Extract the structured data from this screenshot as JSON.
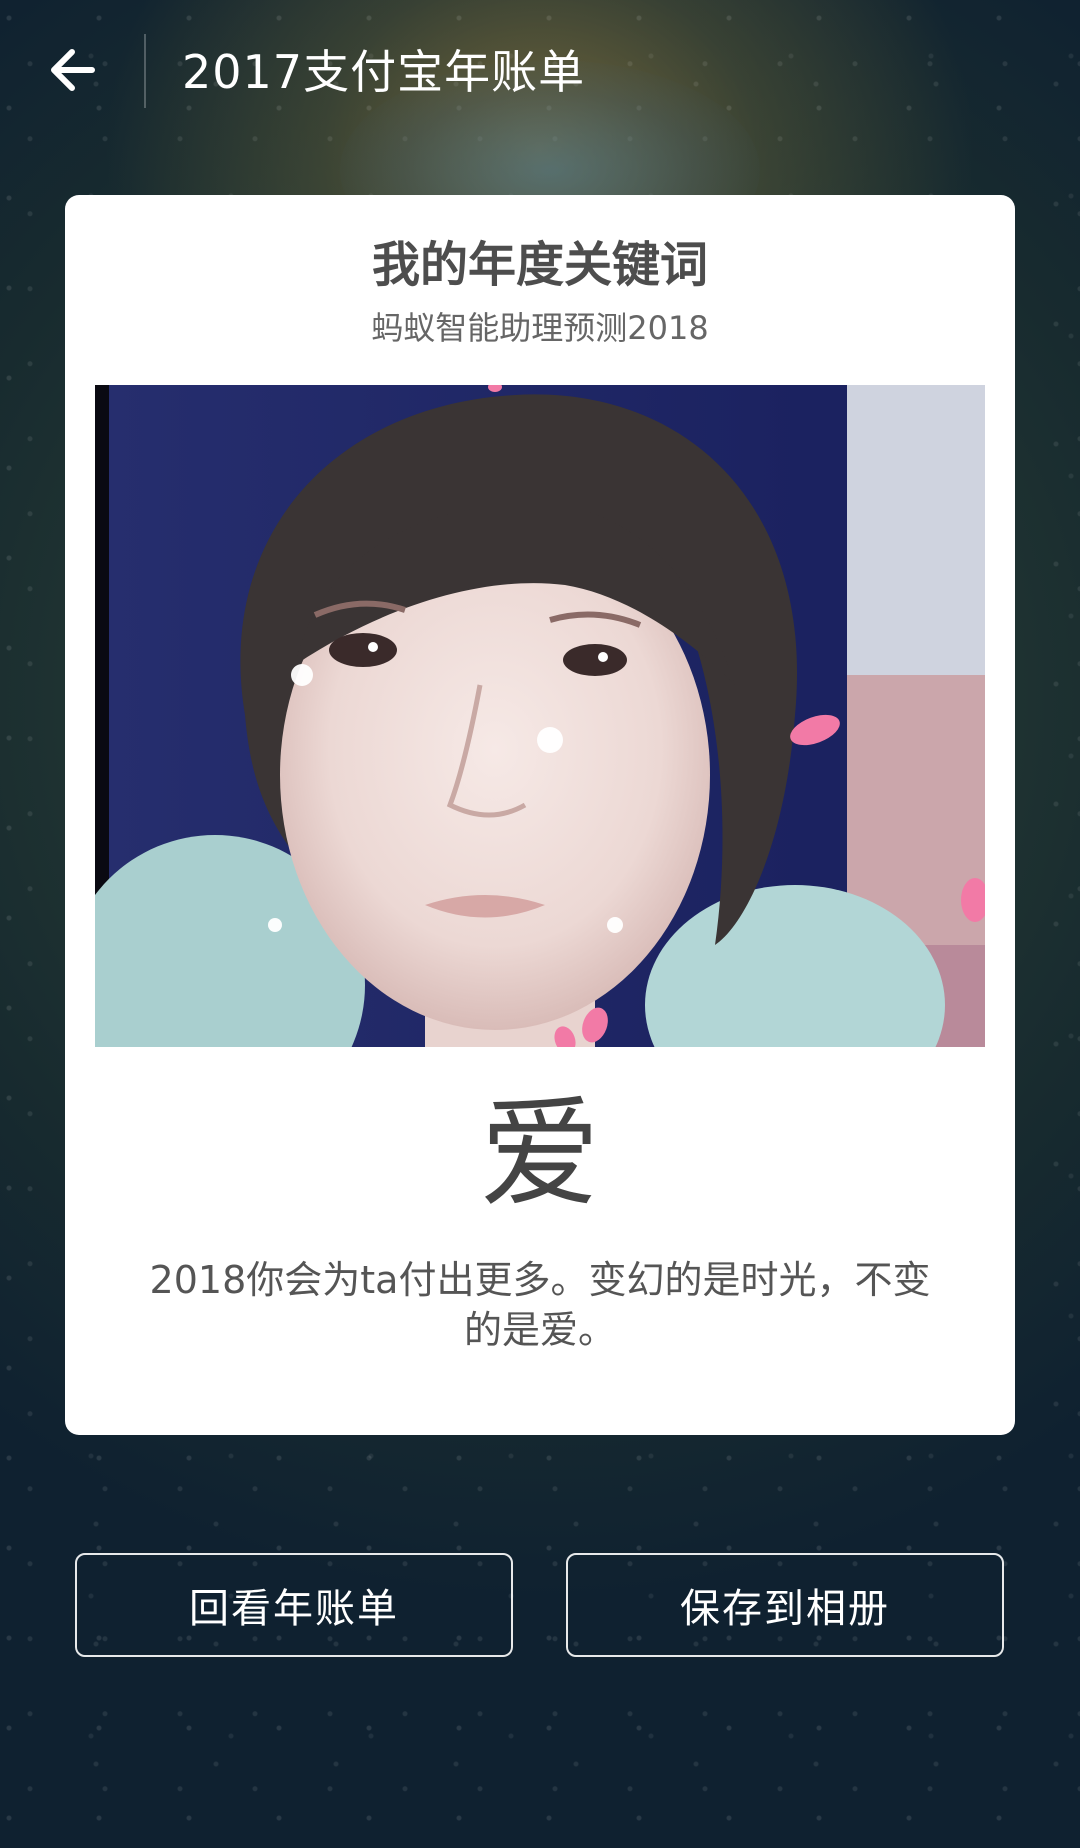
{
  "header": {
    "title": "2017支付宝年账单",
    "back_icon": "arrow-left-icon"
  },
  "card": {
    "title": "我的年度关键词",
    "subtitle": "蚂蚁智能助理预测2018",
    "keyword": "爱",
    "description": "2018你会为ta付出更多。变幻的是时光，不变的是爱。"
  },
  "actions": {
    "review_label": "回看年账单",
    "save_label": "保存到相册"
  },
  "colors": {
    "card_background": "#ffffff",
    "title_text": "#4d4d4d",
    "petal_pink": "#f27aa6"
  }
}
